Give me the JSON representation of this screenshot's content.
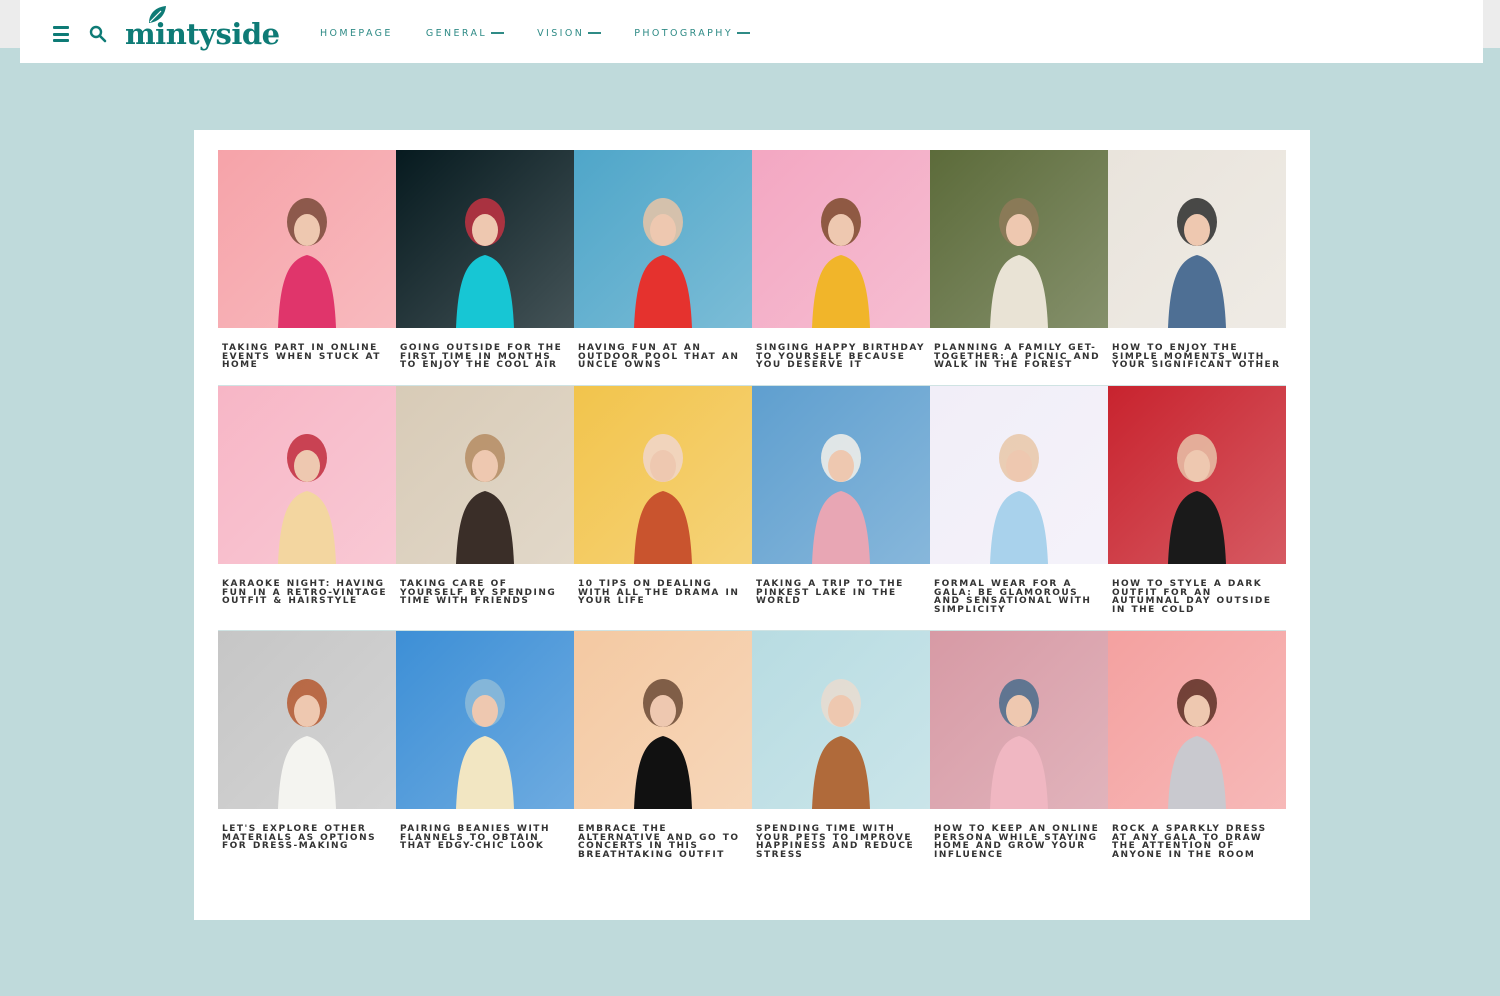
{
  "header": {
    "logo_text": "mintyside",
    "nav": [
      {
        "label": "HOMEPAGE",
        "has_dropdown": false
      },
      {
        "label": "GENERAL",
        "has_dropdown": true
      },
      {
        "label": "VISION",
        "has_dropdown": true
      },
      {
        "label": "PHOTOGRAPHY",
        "has_dropdown": true
      }
    ]
  },
  "colors": {
    "accent": "#0e7b76",
    "background": "#bfdadb"
  },
  "posts": [
    {
      "title": "TAKING PART IN ONLINE EVENTS WHEN STUCK AT HOME",
      "palette": [
        "#f6a3a9",
        "#e0356b",
        "#7a4a3a"
      ]
    },
    {
      "title": "GOING OUTSIDE FOR THE FIRST TIME IN MONTHS TO ENJOY THE COOL AIR",
      "palette": [
        "#061a1f",
        "#17c6d4",
        "#c23242"
      ]
    },
    {
      "title": "HAVING FUN AT AN OUTDOOR POOL THAT AN UNCLE OWNS",
      "palette": [
        "#4fa6c9",
        "#e5322e",
        "#e9c4a6"
      ]
    },
    {
      "title": "SINGING HAPPY BIRTHDAY TO YOURSELF BECAUSE YOU DESERVE IT",
      "palette": [
        "#f3a7c2",
        "#f1b52a",
        "#7c4a2c"
      ]
    },
    {
      "title": "PLANNING A FAMILY GET-TOGETHER: A PICNIC AND WALK IN THE FOREST",
      "palette": [
        "#5c6b3a",
        "#e9e3d5",
        "#8f7a59"
      ]
    },
    {
      "title": "HOW TO ENJOY THE SIMPLE MOMENTS WITH YOUR SIGNIFICANT OTHER",
      "palette": [
        "#e9e4dc",
        "#4e6f94",
        "#2b2b2b"
      ]
    },
    {
      "title": "KARAOKE NIGHT: HAVING FUN IN A RETRO-VINTAGE OUTFIT & HAIRSTYLE",
      "palette": [
        "#f7b6c6",
        "#f3d6a0",
        "#c12d3d"
      ]
    },
    {
      "title": "TAKING CARE OF YOURSELF BY SPENDING TIME WITH FRIENDS",
      "palette": [
        "#d8cbb7",
        "#3a2e28",
        "#b58c63"
      ]
    },
    {
      "title": "10 TIPS ON DEALING WITH ALL THE DRAMA IN YOUR LIFE",
      "palette": [
        "#f2c44c",
        "#c9542e",
        "#f0d6cc"
      ]
    },
    {
      "title": "TAKING A TRIP TO THE PINKEST LAKE IN THE WORLD",
      "palette": [
        "#5f9fcf",
        "#e8a6b4",
        "#f4f1ea"
      ]
    },
    {
      "title": "FORMAL WEAR FOR A GALA: BE GLAMOROUS AND SENSATIONAL WITH SIMPLICITY",
      "palette": [
        "#f1eef8",
        "#a9d2ec",
        "#e8c7a8"
      ]
    },
    {
      "title": "HOW TO STYLE A DARK OUTFIT FOR AN AUTUMNAL DAY OUTSIDE IN THE COLD",
      "palette": [
        "#c8232e",
        "#1a1a1a",
        "#e7c2a8"
      ]
    },
    {
      "title": "LET'S EXPLORE OTHER MATERIALS AS OPTIONS FOR DRESS-MAKING",
      "palette": [
        "#c6c6c6",
        "#f4f4f0",
        "#b5582f"
      ]
    },
    {
      "title": "PAIRING BEANIES WITH FLANNELS TO OBTAIN THAT EDGY-CHIC LOOK",
      "palette": [
        "#3d8fd6",
        "#f2e6c2",
        "#8dbbd8"
      ]
    },
    {
      "title": "EMBRACE THE ALTERNATIVE AND GO TO CONCERTS IN THIS BREATHTAKING OUTFIT",
      "palette": [
        "#f4c9a2",
        "#111111",
        "#6b4a35"
      ]
    },
    {
      "title": "SPENDING TIME WITH YOUR PETS TO IMPROVE HAPPINESS AND REDUCE STRESS",
      "palette": [
        "#b8dce2",
        "#b06a3a",
        "#e9dcd0"
      ]
    },
    {
      "title": "HOW TO KEEP AN ONLINE PERSONA WHILE STAYING HOME AND GROW YOUR INFLUENCE",
      "palette": [
        "#d79aa5",
        "#f0b7c2",
        "#4a6d8c"
      ]
    },
    {
      "title": "ROCK A SPARKLY DRESS AT ANY GALA TO DRAW THE ATTENTION OF ANYONE IN THE ROOM",
      "palette": [
        "#f4a1a0",
        "#c9c9cf",
        "#5c2f24"
      ]
    }
  ]
}
